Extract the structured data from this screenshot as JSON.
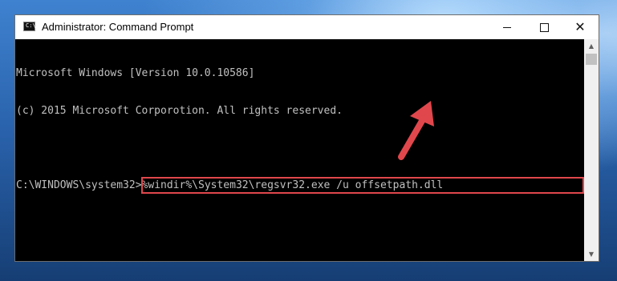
{
  "window": {
    "title": "Administrator: Command Prompt",
    "icon_label": "C:\\",
    "controls": [
      "minimize-icon",
      "maximize-icon",
      "close-icon"
    ],
    "close_glyph": "✕"
  },
  "console": {
    "line1": "Microsoft Windows [Version 10.0.10586]",
    "line2": "(c) 2015 Microsoft Corporotion. All rights reserved.",
    "prompt": "C:\\WINDOWS\\system32>",
    "command": "%windir%\\System32\\regsvr32.exe /u offsetpath.dll"
  },
  "colors": {
    "highlight": "#e0474c",
    "arrow": "#e0474c",
    "console_text": "#c0c0c0",
    "console_bg": "#000000"
  },
  "scrollbar": {
    "up_glyph": "▲",
    "down_glyph": "▼"
  }
}
